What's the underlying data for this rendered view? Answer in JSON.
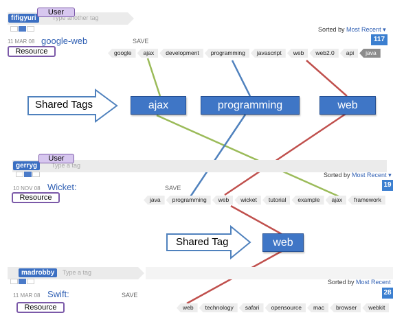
{
  "colors": {
    "green_line": "#9bbb59",
    "blue_line": "#4f81bd",
    "red_line": "#c0504d",
    "arrow_outline": "#4f81bd",
    "callout_border": "#7b59a8",
    "callout_fill": "#d7c7ef",
    "user_chip": "#3b6fc2",
    "tag_box": "#3f76c6"
  },
  "panels": [
    {
      "username": "fifigyuri",
      "tag_placeholder": "Type another tag",
      "user_label": "User",
      "sorted_prefix": "Sorted by",
      "sorted_value": "Most Recent",
      "date": "11 MAR 08",
      "title": "google-web",
      "save": "SAVE",
      "count": "117",
      "resource_label": "Resource",
      "tags": [
        "google",
        "ajax",
        "development",
        "programming",
        "javascript",
        "web",
        "web2.0",
        "api",
        "java"
      ]
    },
    {
      "username": "gerryg",
      "tag_placeholder": "Type a tag",
      "user_label": "User",
      "sorted_prefix": "Sorted by",
      "sorted_value": "Most Recent",
      "date": "10 NOV 08",
      "title": "Wicket:",
      "save": "SAVE",
      "count": "19",
      "resource_label": "Resource",
      "tags": [
        "java",
        "programming",
        "web",
        "wicket",
        "tutorial",
        "example",
        "ajax",
        "framework"
      ]
    },
    {
      "username": "madrobby",
      "tag_placeholder": "Type a tag",
      "sorted_prefix": "Sorted by",
      "sorted_value": "Most Recent",
      "date": "11 MAR 08",
      "title": "Swift:",
      "save": "SAVE",
      "count": "28",
      "resource_label": "Resource",
      "tags": [
        "web",
        "technology",
        "safari",
        "opensource",
        "mac",
        "browser",
        "webkit"
      ]
    }
  ],
  "shared_tags_label": "Shared Tags",
  "shared_tags": [
    "ajax",
    "programming",
    "web"
  ],
  "shared_tag_label": "Shared Tag",
  "shared_tag": "web",
  "icons": {
    "view_toggle": "list-view-icons",
    "sort_chevron": "chevron-down-icon",
    "block_arrow": "right-block-arrow"
  }
}
